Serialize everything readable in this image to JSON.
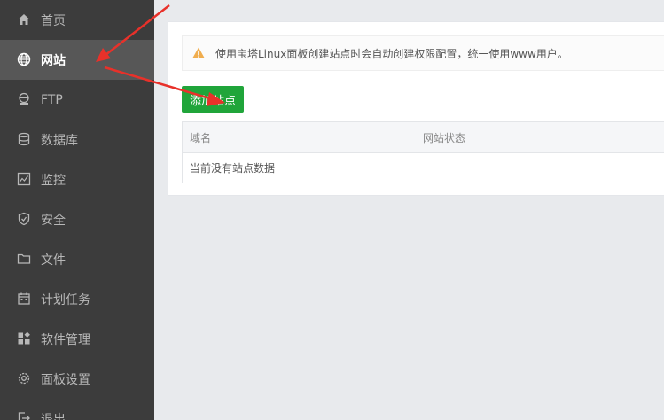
{
  "sidebar": {
    "items": [
      {
        "icon": "home-icon",
        "label": "首页"
      },
      {
        "icon": "globe-icon",
        "label": "网站",
        "active": true
      },
      {
        "icon": "ftp-icon",
        "label": "FTP"
      },
      {
        "icon": "database-icon",
        "label": "数据库"
      },
      {
        "icon": "monitor-chart-icon",
        "label": "监控"
      },
      {
        "icon": "shield-icon",
        "label": "安全"
      },
      {
        "icon": "folder-icon",
        "label": "文件"
      },
      {
        "icon": "calendar-icon",
        "label": "计划任务"
      },
      {
        "icon": "apps-icon",
        "label": "软件管理"
      },
      {
        "icon": "gear-icon",
        "label": "面板设置"
      },
      {
        "icon": "logout-icon",
        "label": "退出"
      }
    ]
  },
  "main": {
    "alert_text": "使用宝塔Linux面板创建站点时会自动创建权限配置，统一使用www用户。",
    "add_site_label": "添加站点",
    "table": {
      "columns": [
        "域名",
        "网站状态"
      ],
      "empty_text": "当前没有站点数据"
    }
  },
  "colors": {
    "sidebar_bg": "#3c3c3c",
    "sidebar_active": "#575757",
    "primary_green": "#20a53a",
    "warning_orange": "#f0ad4e",
    "annotation_red": "#e8312a"
  }
}
